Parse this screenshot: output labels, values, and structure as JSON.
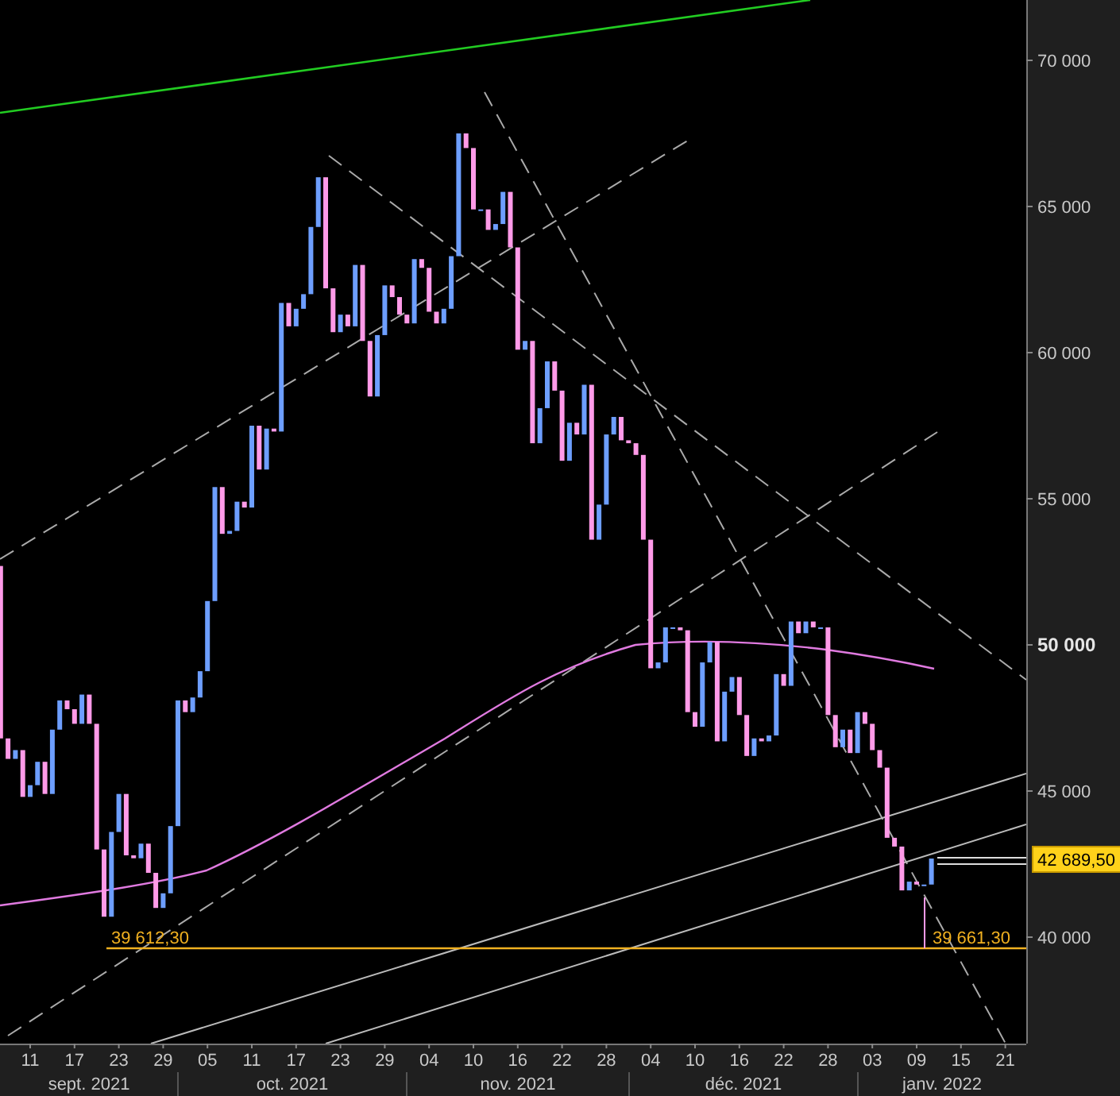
{
  "price_axis": {
    "labels": [
      {
        "text": "70 000",
        "emphasized": false
      },
      {
        "text": "65 000",
        "emphasized": false
      },
      {
        "text": "60 000",
        "emphasized": false
      },
      {
        "text": "55 000",
        "emphasized": false
      },
      {
        "text": "50 000",
        "emphasized": true
      },
      {
        "text": "45 000",
        "emphasized": false
      },
      {
        "text": "40 000",
        "emphasized": false
      }
    ]
  },
  "date_axis": {
    "days": [
      "11",
      "17",
      "23",
      "29",
      "05",
      "11",
      "17",
      "23",
      "29",
      "04",
      "10",
      "16",
      "22",
      "28",
      "04",
      "10",
      "16",
      "22",
      "28",
      "03",
      "09",
      "15",
      "21"
    ],
    "months": [
      "sept. 2021",
      "oct. 2021",
      "nov. 2021",
      "déc. 2021",
      "janv. 2022"
    ]
  },
  "last_price_tag": "42 689,50",
  "low_labels": [
    "39 612,30",
    "39 661,30"
  ]
}
